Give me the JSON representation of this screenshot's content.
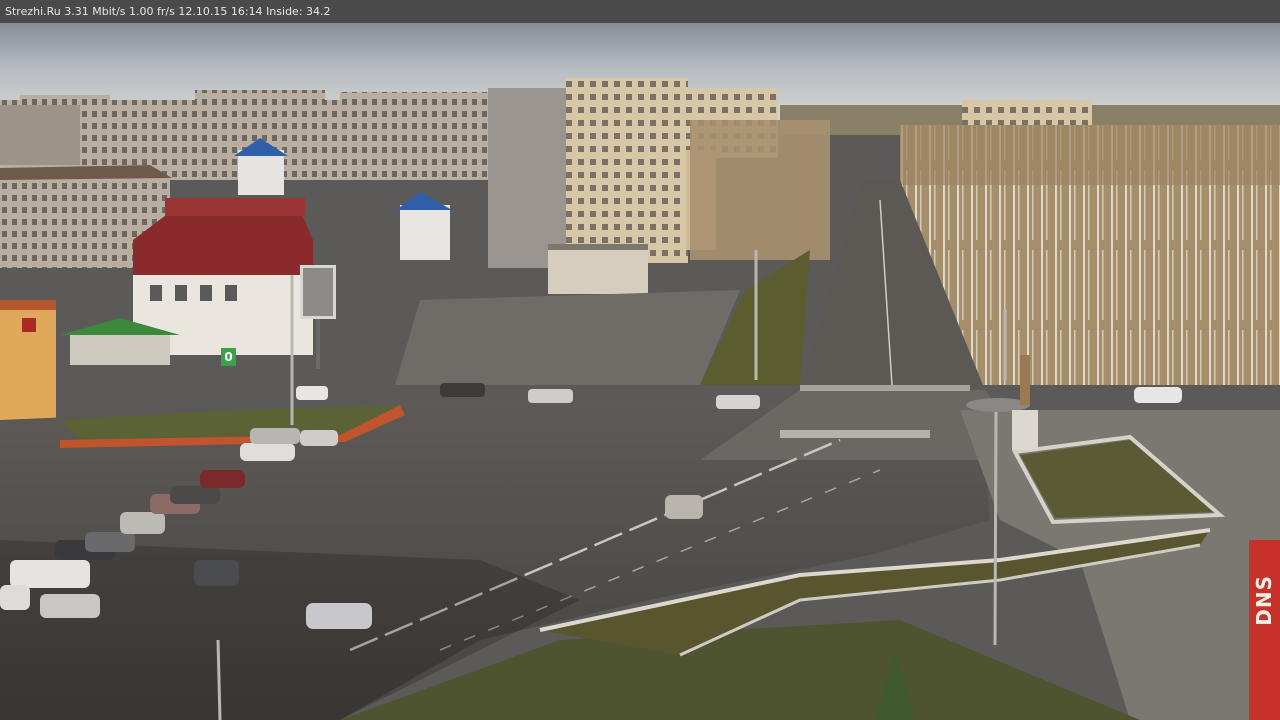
{
  "overlay": {
    "site": "Strezhi.Ru",
    "bitrate": "3.31 Mbit/s",
    "framerate": "1.00 fr/s",
    "date": "12.10.15",
    "time": "16:14",
    "inside_label": "Inside:",
    "inside_value": "34.2"
  },
  "signs": {
    "store_sign": "DNS",
    "route_sign": "0"
  },
  "colors": {
    "sky_top": "#6f7782",
    "sky_bottom": "#cfd2d4",
    "asphalt": "#4a4847",
    "asphalt_light": "#57514c",
    "trees": "#b49a74",
    "grass": "#5a5a34",
    "building_panel": "#b8ada0",
    "red_roof": "#8a2a2c",
    "blue_roof": "#2f5fa8",
    "dns_red": "#c8312a"
  }
}
